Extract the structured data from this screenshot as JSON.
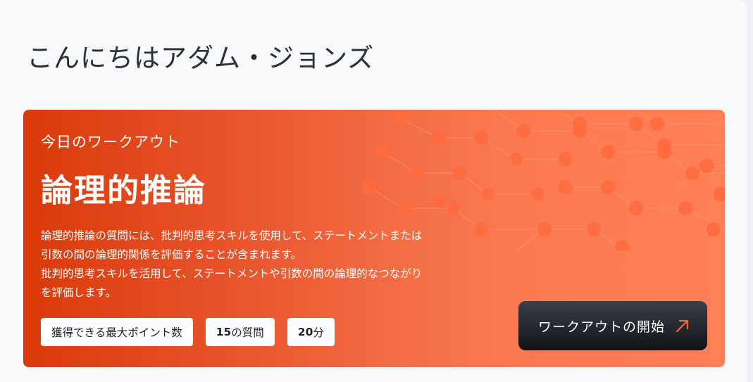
{
  "greeting": "こんにちはアダム・ジョンズ",
  "workout": {
    "eyebrow": "今日のワークアウト",
    "title": "論理的推論",
    "description_lines": [
      "論理的推論の質問には、批判的思考スキルを使用して、ステートメントまたは",
      "引数の間の論理的関係を評価することが含まれます。",
      "批判的思考スキルを活用して、ステートメントや引数の間の論理的なつながり",
      "を評価します。"
    ],
    "chips": {
      "max_points": "獲得できる最大ポイント数",
      "questions_count": "15",
      "questions_suffix": "の質問",
      "minutes_count": "20",
      "minutes_suffix": "分"
    },
    "start_button_label": "ワークアウトの開始",
    "start_button_icon": "arrow-up-right-icon"
  },
  "colors": {
    "page_background": "#f8f9fb",
    "card_gradient_start": "#d93a0a",
    "card_gradient_end": "#ff7f57",
    "button_dark": "#111318",
    "arrow_accent": "#f26a3c"
  }
}
